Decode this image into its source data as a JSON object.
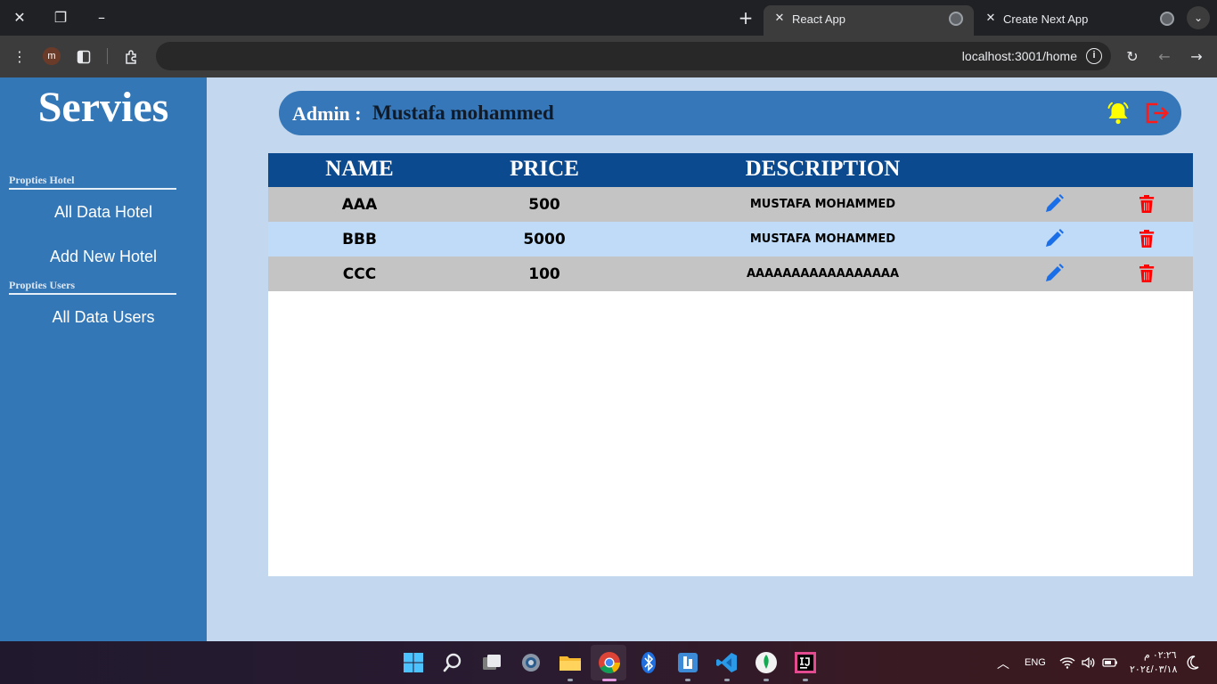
{
  "browser": {
    "tabs": [
      {
        "title": "React App",
        "active": true
      },
      {
        "title": "Create Next App",
        "active": false
      }
    ],
    "profile_initial": "m",
    "url": "localhost:3001/home"
  },
  "sidebar": {
    "brand": "Servies",
    "sections": [
      {
        "title": "Propties Hotel",
        "items": [
          "All Data Hotel",
          "Add New Hotel"
        ]
      },
      {
        "title": "Propties Users",
        "items": [
          "All Data Users"
        ]
      }
    ]
  },
  "header": {
    "admin_label": "Admin :",
    "admin_name": "Mustafa mohammed",
    "colors": {
      "bell": "#ffff00",
      "logout": "#ff1a1a"
    }
  },
  "table": {
    "columns": [
      "NAME",
      "PRICE",
      "DESCRIPTION"
    ],
    "rows": [
      {
        "name": "AAA",
        "price": "500",
        "description": "MUSTAFA MOHAMMED"
      },
      {
        "name": "BBB",
        "price": "5000",
        "description": "MUSTAFA MOHAMMED"
      },
      {
        "name": "CCC",
        "price": "100",
        "description": "AAAAAAAAAAAAAAAAA"
      }
    ],
    "colors": {
      "edit": "#1a6fe8",
      "delete": "#ff0000",
      "header": "#0c4a8f"
    }
  },
  "taskbar": {
    "tray": {
      "language": "ENG",
      "time": "٠٢:٢٦ م",
      "date": "٢٠٢٤/٠٣/١٨"
    }
  }
}
